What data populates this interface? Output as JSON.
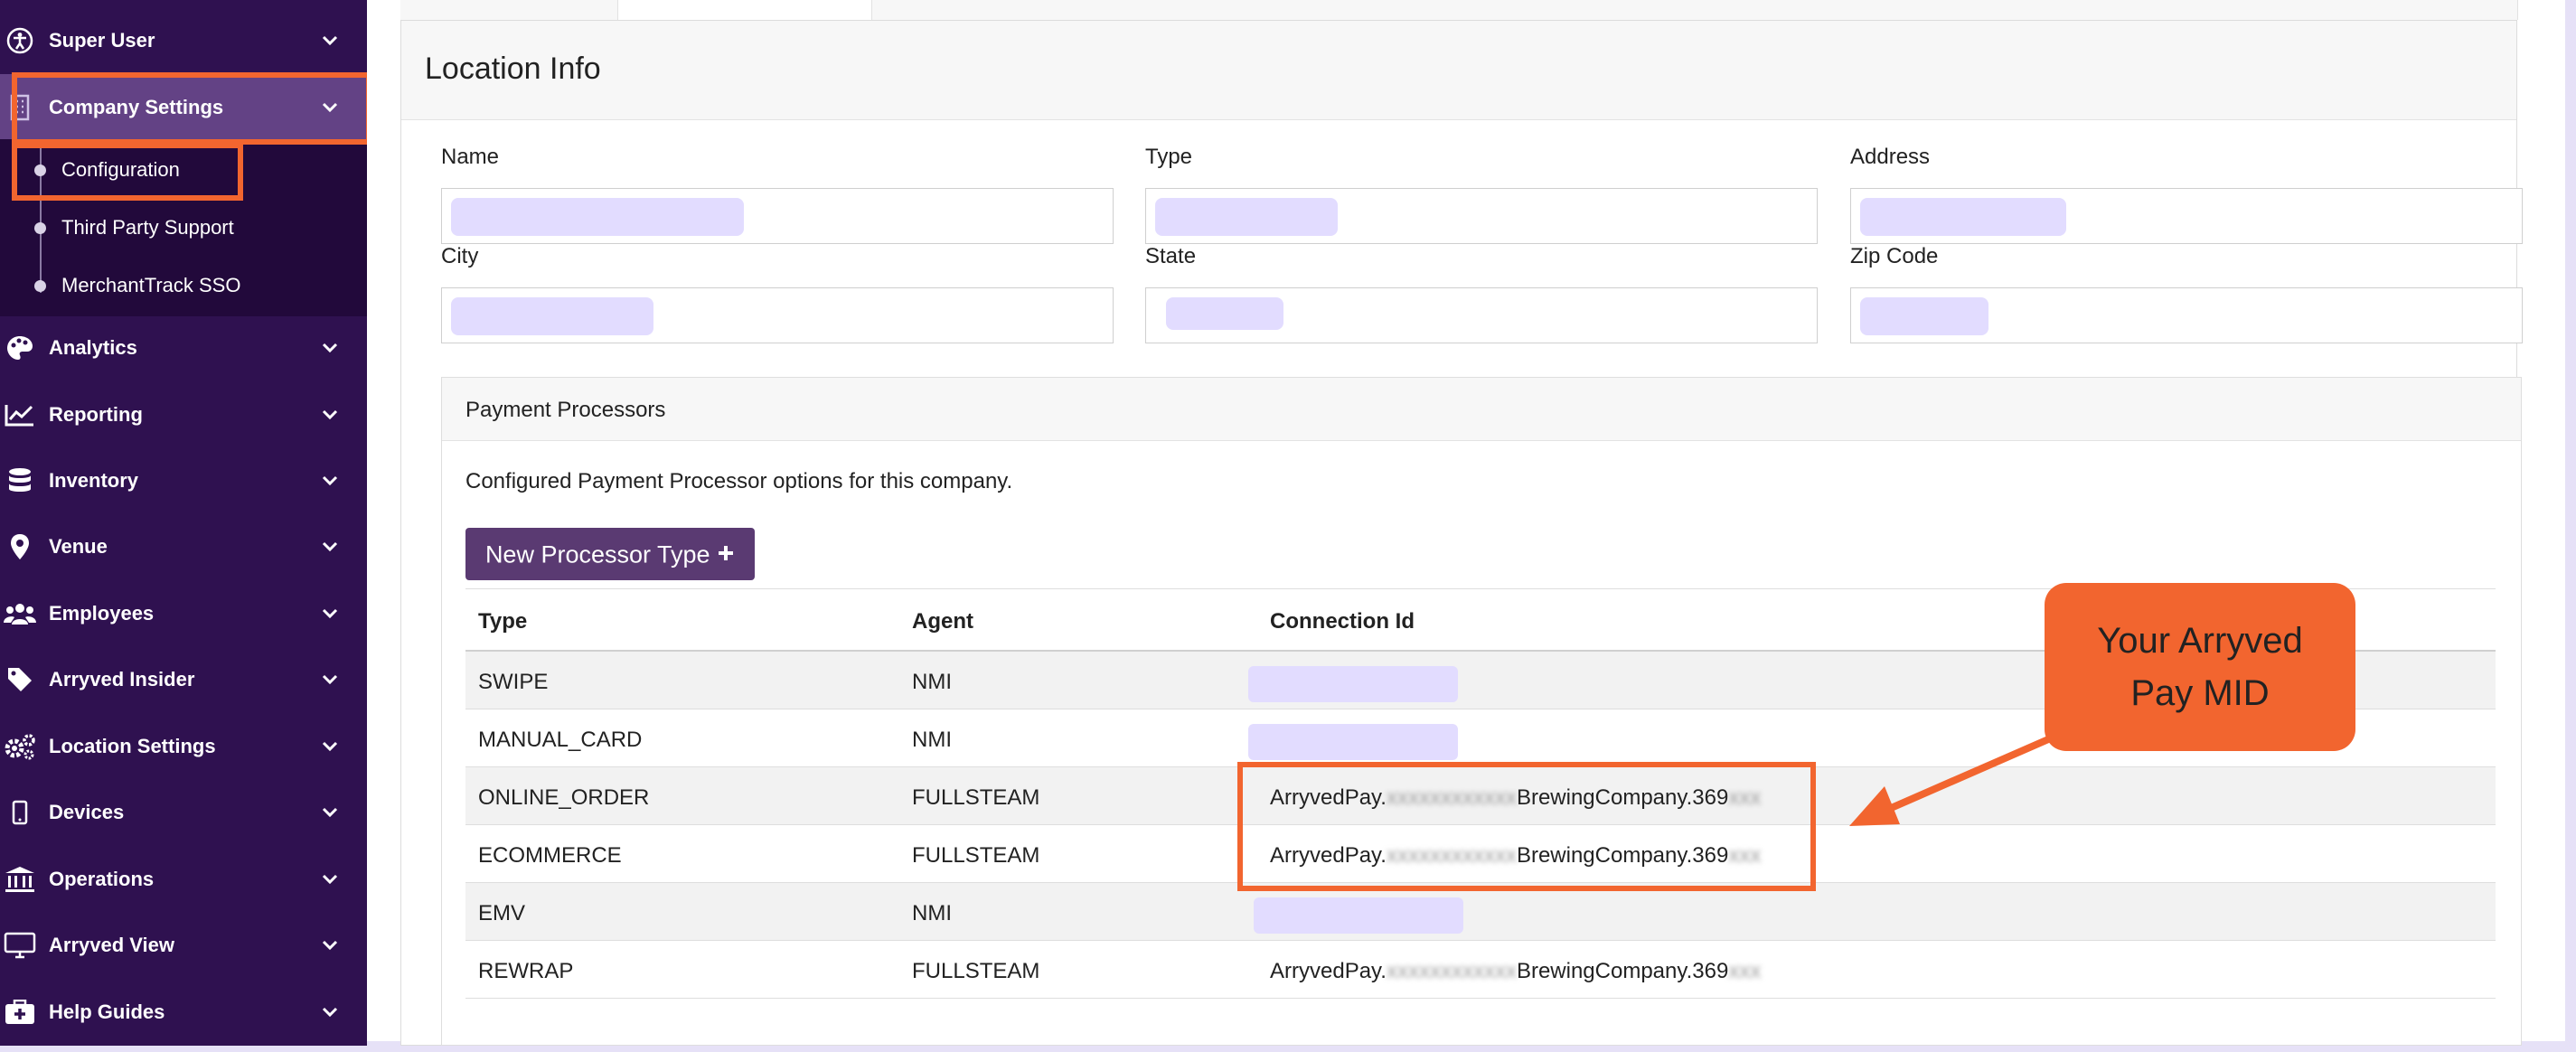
{
  "sidebar": {
    "items": [
      {
        "label": "Super User",
        "icon": "accessibility-icon"
      },
      {
        "label": "Company Settings",
        "icon": "building-icon"
      },
      {
        "label": "Analytics",
        "icon": "palette-icon"
      },
      {
        "label": "Reporting",
        "icon": "chart-line-icon"
      },
      {
        "label": "Inventory",
        "icon": "database-icon"
      },
      {
        "label": "Venue",
        "icon": "map-pin-icon"
      },
      {
        "label": "Employees",
        "icon": "users-icon"
      },
      {
        "label": "Arryved Insider",
        "icon": "tag-icon"
      },
      {
        "label": "Location Settings",
        "icon": "gears-icon"
      },
      {
        "label": "Devices",
        "icon": "mobile-icon"
      },
      {
        "label": "Operations",
        "icon": "bank-icon"
      },
      {
        "label": "Arryved View",
        "icon": "desktop-icon"
      },
      {
        "label": "Help Guides",
        "icon": "first-aid-icon"
      }
    ],
    "subitems": [
      {
        "label": "Configuration"
      },
      {
        "label": "Third Party Support"
      },
      {
        "label": "MerchantTrack SSO"
      }
    ]
  },
  "location_info": {
    "title": "Location Info",
    "fields": {
      "name": {
        "label": "Name",
        "value": ""
      },
      "type": {
        "label": "Type",
        "value": ""
      },
      "address": {
        "label": "Address",
        "value": ""
      },
      "city": {
        "label": "City",
        "value": ""
      },
      "state": {
        "label": "State",
        "value": ""
      },
      "zip": {
        "label": "Zip Code",
        "value": ""
      }
    }
  },
  "payment_processors": {
    "title": "Payment Processors",
    "description": "Configured Payment Processor options for this company.",
    "new_button_label": "New Processor Type",
    "new_button_icon": "plus-icon",
    "columns": [
      "Type",
      "Agent",
      "Connection Id"
    ],
    "rows": [
      {
        "type": "SWIPE",
        "agent": "NMI",
        "connection_id": ""
      },
      {
        "type": "MANUAL_CARD",
        "agent": "NMI",
        "connection_id": ""
      },
      {
        "type": "ONLINE_ORDER",
        "agent": "FULLSTEAM",
        "connection_id": "ArryvedPay.BrewingCompany.369"
      },
      {
        "type": "ECOMMERCE",
        "agent": "FULLSTEAM",
        "connection_id": "ArryvedPay.BrewingCompany.369"
      },
      {
        "type": "EMV",
        "agent": "NMI",
        "connection_id": ""
      },
      {
        "type": "REWRAP",
        "agent": "FULLSTEAM",
        "connection_id": "ArryvedPay.BrewingCompany.369"
      }
    ],
    "conn_prefix": "ArryvedPay.",
    "conn_suffix": "BrewingCompany.369"
  },
  "annotation": {
    "callout_line1": "Your Arryved",
    "callout_line2": "Pay MID"
  },
  "colors": {
    "sidebar_bg": "#2f1150",
    "sidebar_active": "#634285",
    "submenu_bg": "#22093b",
    "accent_orange": "#f2652f",
    "button_purple": "#5a3a72",
    "redaction": "#e2dcff"
  }
}
